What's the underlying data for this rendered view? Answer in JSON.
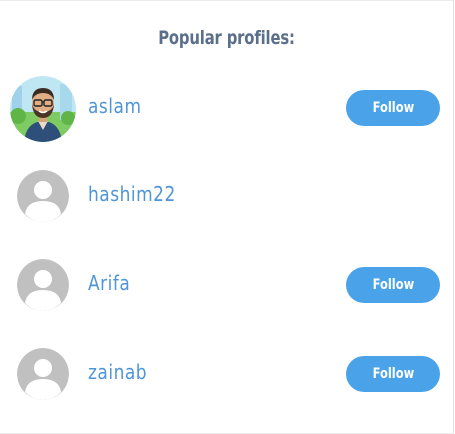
{
  "title": "Popular profiles:",
  "profiles": [
    {
      "username": "aslam",
      "avatar": "bitmoji-avatar",
      "follow_label": "Follow"
    },
    {
      "username": "hashim22",
      "avatar": "default-avatar-icon",
      "follow_label": ""
    },
    {
      "username": "Arifa",
      "avatar": "default-avatar-icon",
      "follow_label": "Follow"
    },
    {
      "username": "zainab",
      "avatar": "default-avatar-icon",
      "follow_label": "Follow"
    }
  ],
  "colors": {
    "title": "#5a6f8a",
    "username": "#4f95d8",
    "button": "#4aa3e8",
    "avatar_placeholder": "#c0c0c0"
  }
}
